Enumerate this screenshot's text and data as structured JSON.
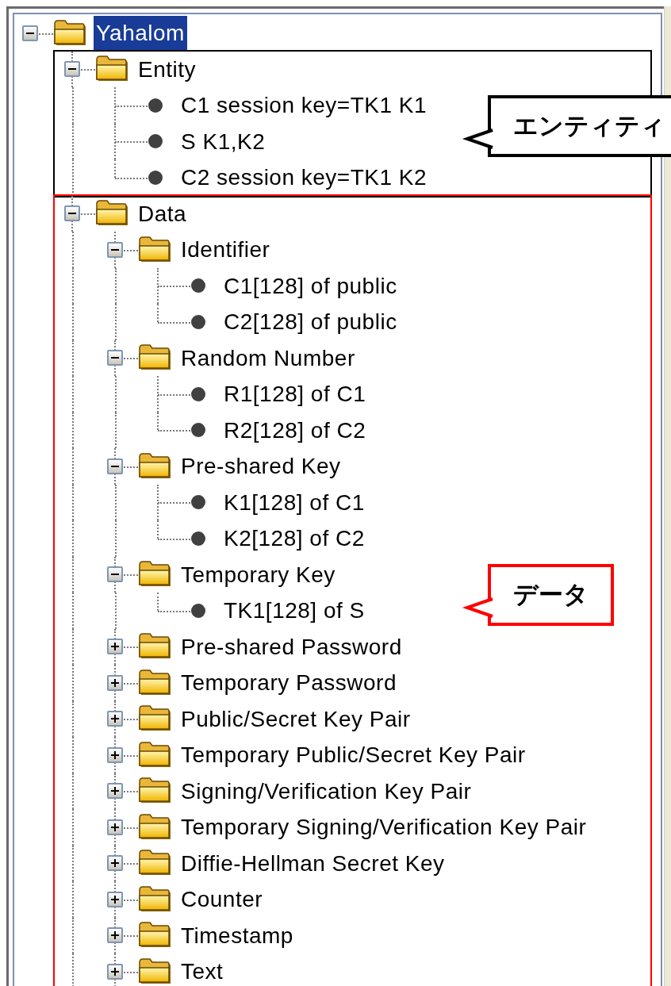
{
  "tree": {
    "items": [
      {
        "label": "Yahalom",
        "kind": "folder",
        "expanded": true,
        "selected": true,
        "children": [
          {
            "label": "Entity",
            "kind": "folder",
            "expanded": true,
            "selected": false,
            "color": "#000000",
            "children": [
              {
                "label": "C1 session key=TK1 K1",
                "kind": "leaf",
                "selected": false
              },
              {
                "label": "S K1,K2",
                "kind": "leaf",
                "selected": false,
                "callout": {
                  "text": "エンティティ",
                  "color": "#000000"
                }
              },
              {
                "label": "C2 session key=TK1 K2",
                "kind": "leaf",
                "selected": false
              }
            ]
          },
          {
            "label": "Data",
            "kind": "folder",
            "expanded": true,
            "selected": false,
            "color": "#ff0000",
            "continues": true,
            "children": [
              {
                "label": "Identifier",
                "kind": "folder",
                "expanded": true,
                "selected": false,
                "children": [
                  {
                    "label": "C1[128] of public",
                    "kind": "leaf",
                    "selected": false
                  },
                  {
                    "label": "C2[128] of public",
                    "kind": "leaf",
                    "selected": false
                  }
                ]
              },
              {
                "label": "Random Number",
                "kind": "folder",
                "expanded": true,
                "selected": false,
                "children": [
                  {
                    "label": "R1[128] of C1",
                    "kind": "leaf",
                    "selected": false
                  },
                  {
                    "label": "R2[128] of C2",
                    "kind": "leaf",
                    "selected": false
                  }
                ]
              },
              {
                "label": "Pre-shared Key",
                "kind": "folder",
                "expanded": true,
                "selected": false,
                "children": [
                  {
                    "label": "K1[128] of C1",
                    "kind": "leaf",
                    "selected": false
                  },
                  {
                    "label": "K2[128] of C2",
                    "kind": "leaf",
                    "selected": false
                  }
                ]
              },
              {
                "label": "Temporary Key",
                "kind": "folder",
                "expanded": true,
                "selected": false,
                "children": [
                  {
                    "label": "TK1[128] of S",
                    "kind": "leaf",
                    "selected": false,
                    "callout": {
                      "text": "データ",
                      "color": "#ff0000"
                    }
                  }
                ]
              },
              {
                "label": "Pre-shared Password",
                "kind": "folder",
                "expanded": false,
                "selected": false
              },
              {
                "label": "Temporary Password",
                "kind": "folder",
                "expanded": false,
                "selected": false
              },
              {
                "label": "Public/Secret Key Pair",
                "kind": "folder",
                "expanded": false,
                "selected": false
              },
              {
                "label": "Temporary Public/Secret Key Pair",
                "kind": "folder",
                "expanded": false,
                "selected": false
              },
              {
                "label": "Signing/Verification Key Pair",
                "kind": "folder",
                "expanded": false,
                "selected": false
              },
              {
                "label": "Temporary Signing/Verification Key Pair",
                "kind": "folder",
                "expanded": false,
                "selected": false
              },
              {
                "label": "Diffie-Hellman Secret Key",
                "kind": "folder",
                "expanded": false,
                "selected": false
              },
              {
                "label": "Counter",
                "kind": "folder",
                "expanded": false,
                "selected": false
              },
              {
                "label": "Timestamp",
                "kind": "folder",
                "expanded": false,
                "selected": false
              },
              {
                "label": "Text",
                "kind": "folder",
                "expanded": false,
                "selected": false,
                "continues": true
              }
            ]
          }
        ]
      }
    ]
  }
}
